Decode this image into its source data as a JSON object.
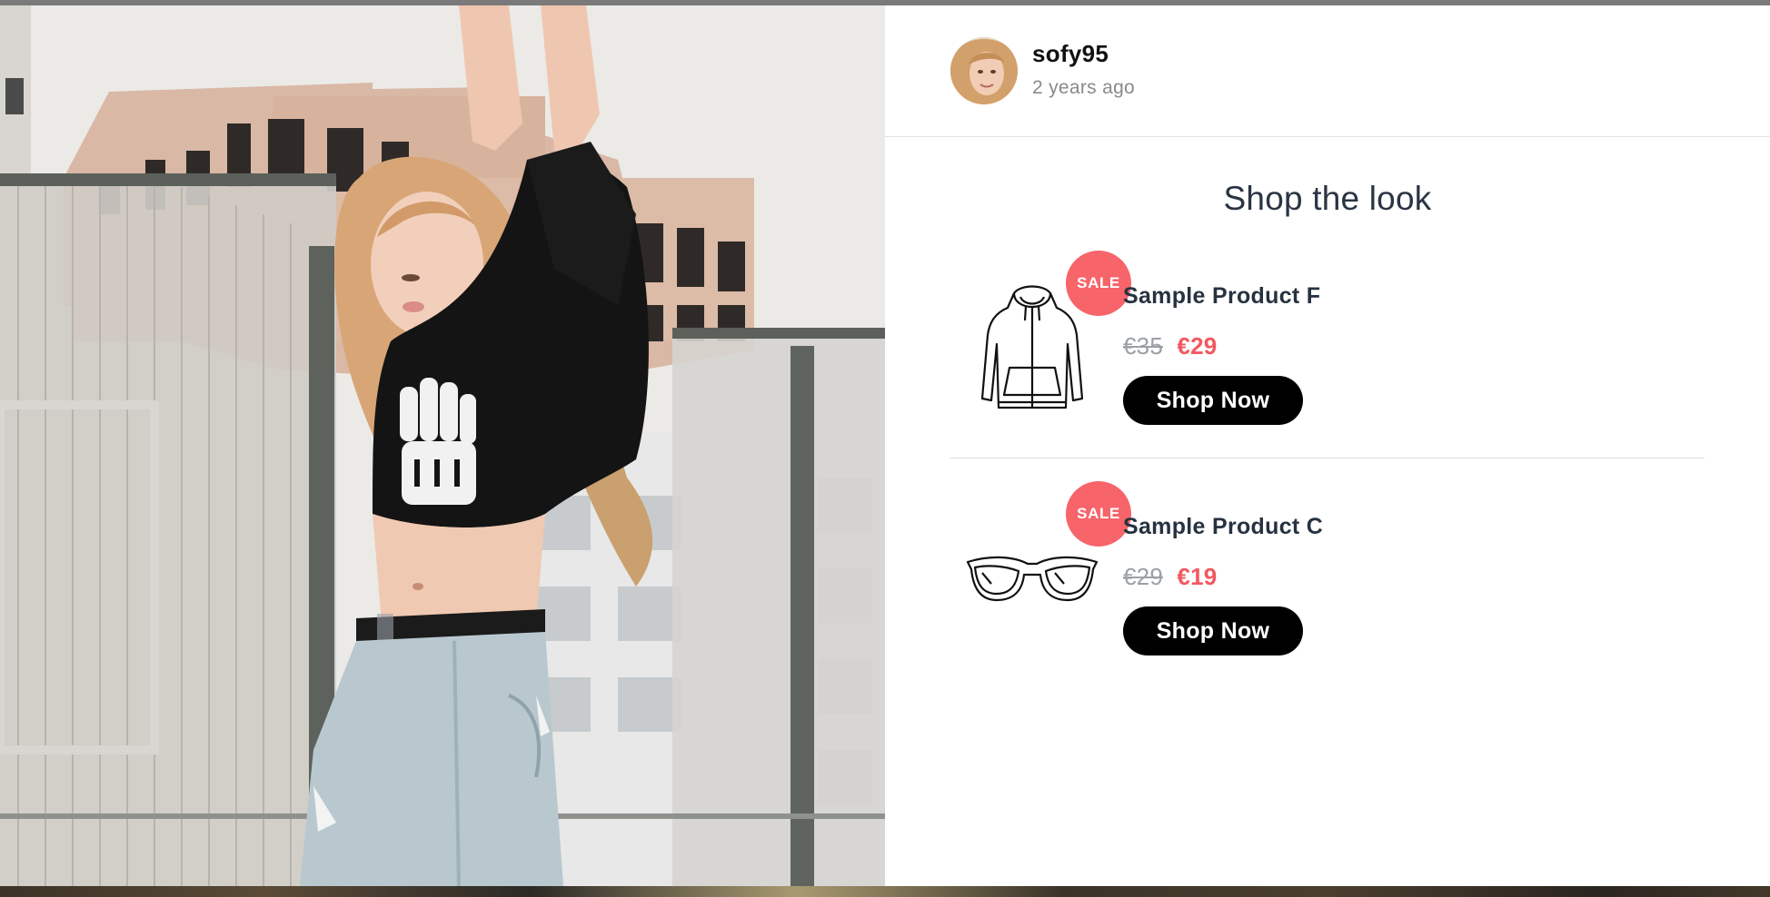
{
  "post": {
    "username": "sofy95",
    "time_ago": "2 years ago",
    "avatar_icon": "user-avatar-photo",
    "photo_icon": "model-wearing-black-crop-top-photo"
  },
  "shop": {
    "title": "Shop the look",
    "products": [
      {
        "badge": "SALE",
        "name": "Sample Product F",
        "old_price": "€35",
        "new_price": "€29",
        "button": "Shop Now",
        "icon": "hoodie-icon"
      },
      {
        "badge": "SALE",
        "name": "Sample Product C",
        "old_price": "€29",
        "new_price": "€19",
        "button": "Shop Now",
        "icon": "sunglasses-icon"
      }
    ]
  },
  "colors": {
    "sale_badge": "#f7646a",
    "sale_price": "#f2585f",
    "old_price": "#9aa0a6",
    "button_bg": "#000000",
    "title_text": "#2a3443"
  }
}
